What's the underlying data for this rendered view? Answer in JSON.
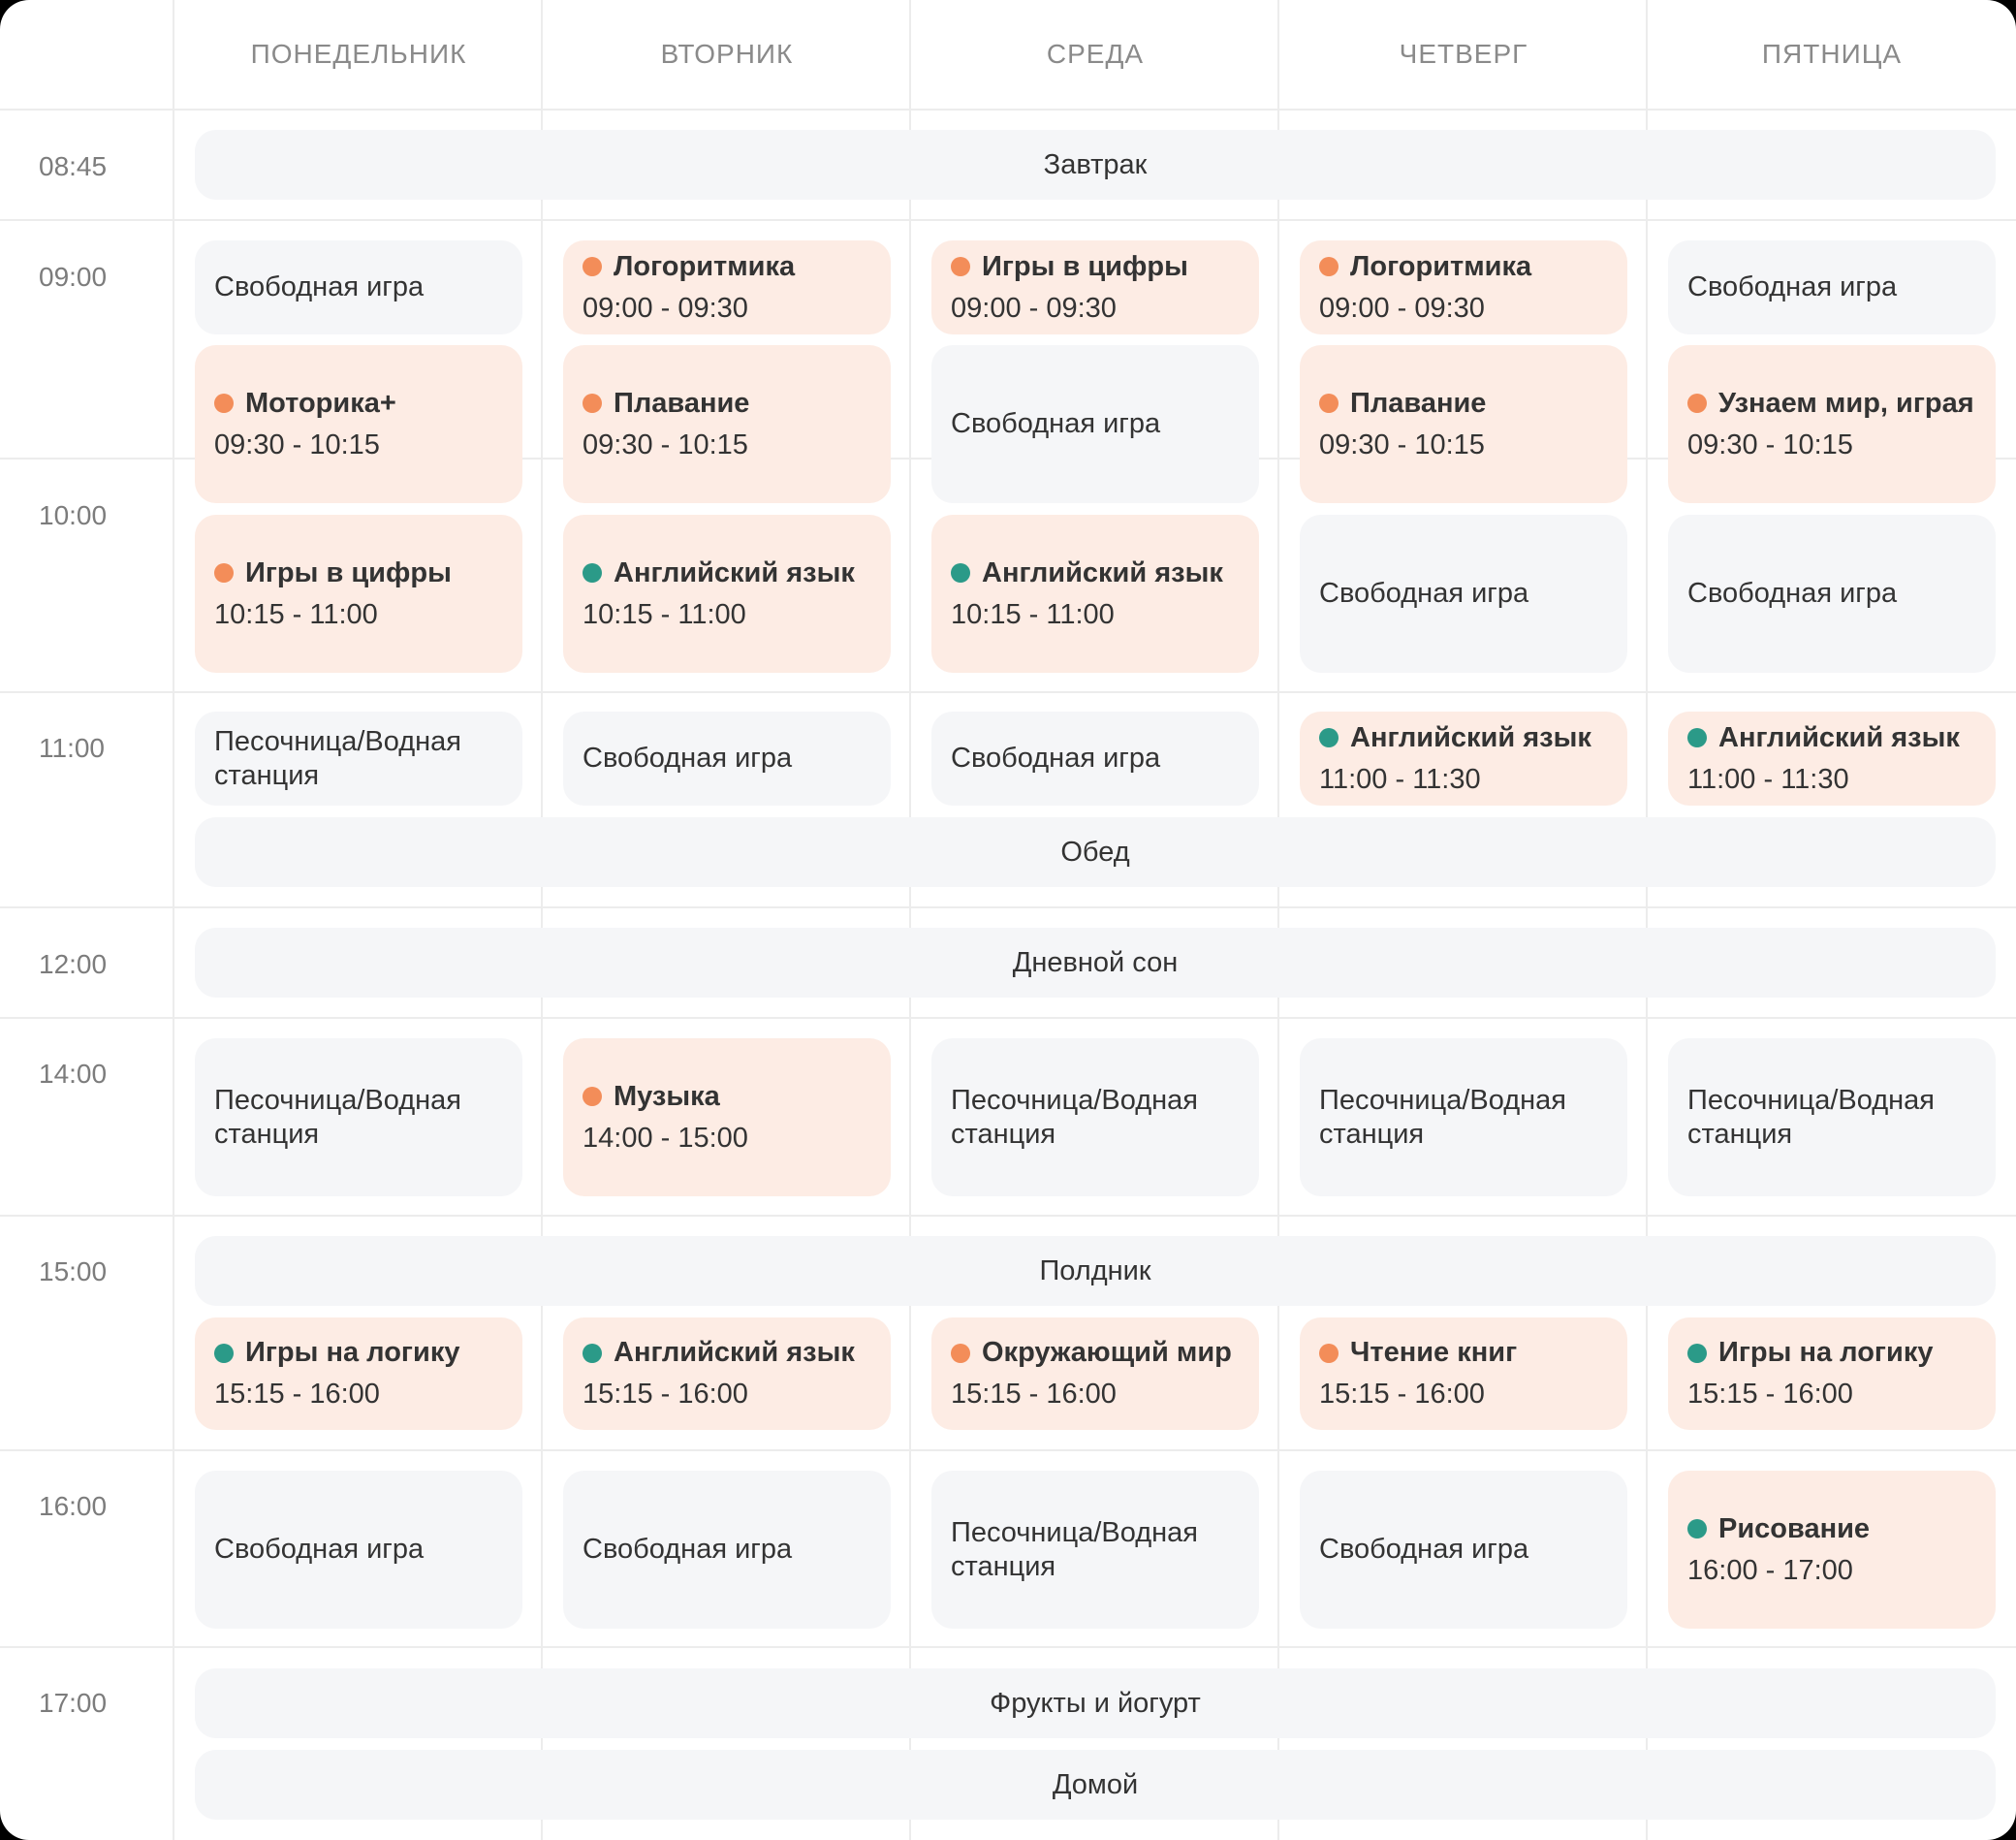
{
  "colors": {
    "orange": "#f38d59",
    "teal": "#2b9a88",
    "peach": "#fdece4",
    "grey": "#f5f6f8"
  },
  "days": [
    "ПОНЕДЕЛЬНИК",
    "ВТОРНИК",
    "СРЕДА",
    "ЧЕТВЕРГ",
    "ПЯТНИЦА"
  ],
  "times": [
    "08:45",
    "09:00",
    "10:00",
    "11:00",
    "12:00",
    "14:00",
    "15:00",
    "16:00",
    "17:00"
  ],
  "common": {
    "breakfast": "Завтрак",
    "lunch": "Обед",
    "nap": "Дневной сон",
    "snack": "Полдник",
    "fruits": "Фрукты и йогурт",
    "home": "Домой"
  },
  "cells": {
    "mon_0900": {
      "text": "Свободная игра"
    },
    "tue_0900": {
      "title": "Логоритмика",
      "time": "09:00 - 09:30",
      "dot": "orange"
    },
    "wed_0900": {
      "title": "Игры в цифры",
      "time": "09:00 - 09:30",
      "dot": "orange"
    },
    "thu_0900": {
      "title": "Логоритмика",
      "time": "09:00 - 09:30",
      "dot": "orange"
    },
    "fri_0900": {
      "text": "Свободная игра"
    },
    "mon_0930": {
      "title": "Моторика+",
      "time": "09:30 - 10:15",
      "dot": "orange"
    },
    "tue_0930": {
      "title": "Плавание",
      "time": "09:30 - 10:15",
      "dot": "orange"
    },
    "wed_0930": {
      "text": "Свободная игра"
    },
    "thu_0930": {
      "title": "Плавание",
      "time": "09:30 - 10:15",
      "dot": "orange"
    },
    "fri_0930": {
      "title": "Узнаем мир, играя",
      "time": "09:30 - 10:15",
      "dot": "orange"
    },
    "mon_1015": {
      "title": "Игры в цифры",
      "time": "10:15 - 11:00",
      "dot": "orange"
    },
    "tue_1015": {
      "title": "Английский язык",
      "time": "10:15 - 11:00",
      "dot": "teal"
    },
    "wed_1015": {
      "title": "Английский язык",
      "time": "10:15 - 11:00",
      "dot": "teal"
    },
    "thu_1015": {
      "text": "Свободная игра"
    },
    "fri_1015": {
      "text": "Свободная игра"
    },
    "mon_1100": {
      "text": "Песочница/Водная станция"
    },
    "tue_1100": {
      "text": "Свободная игра"
    },
    "wed_1100": {
      "text": "Свободная игра"
    },
    "thu_1100": {
      "title": "Английский язык",
      "time": "11:00 - 11:30",
      "dot": "teal"
    },
    "fri_1100": {
      "title": "Английский язык",
      "time": "11:00 - 11:30",
      "dot": "teal"
    },
    "mon_1400": {
      "text": "Песочница/Водная станция"
    },
    "tue_1400": {
      "title": "Музыка",
      "time": "14:00 - 15:00",
      "dot": "orange"
    },
    "wed_1400": {
      "text": "Песочница/Водная станция"
    },
    "thu_1400": {
      "text": "Песочница/Водная станция"
    },
    "fri_1400": {
      "text": "Песочница/Водная станция"
    },
    "mon_1515": {
      "title": "Игры на логику",
      "time": "15:15 - 16:00",
      "dot": "teal"
    },
    "tue_1515": {
      "title": "Английский язык",
      "time": "15:15 - 16:00",
      "dot": "teal"
    },
    "wed_1515": {
      "title": "Окружающий мир",
      "time": "15:15 - 16:00",
      "dot": "orange"
    },
    "thu_1515": {
      "title": "Чтение книг",
      "time": "15:15 - 16:00",
      "dot": "orange"
    },
    "fri_1515": {
      "title": "Игры на логику",
      "time": "15:15 - 16:00",
      "dot": "teal"
    },
    "mon_1600": {
      "text": "Свободная игра"
    },
    "tue_1600": {
      "text": "Свободная игра"
    },
    "wed_1600": {
      "text": "Песочница/Водная станция"
    },
    "thu_1600": {
      "text": "Свободная игра"
    },
    "fri_1600": {
      "title": "Рисование",
      "time": "16:00 - 17:00",
      "dot": "teal"
    }
  }
}
